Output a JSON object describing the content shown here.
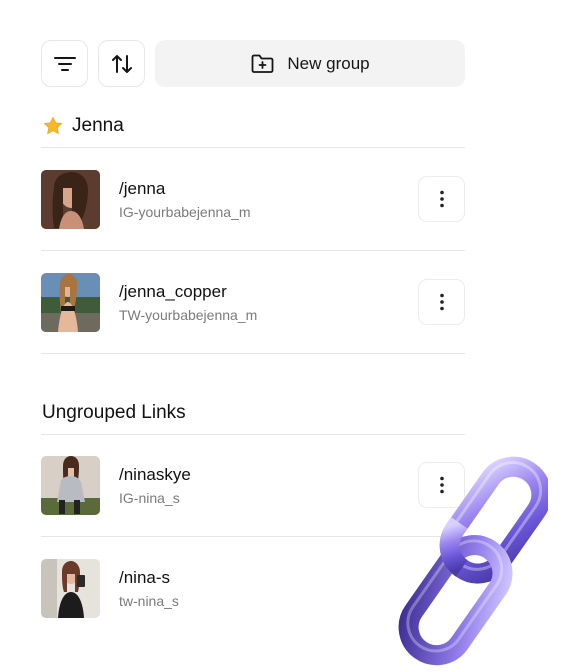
{
  "toolbar": {
    "filter_icon": "filter-lines-icon",
    "sort_icon": "sort-arrows-icon",
    "new_group_icon": "folder-plus-icon",
    "new_group_label": "New group"
  },
  "groups": [
    {
      "icon": "star-icon",
      "title": "Jenna",
      "links": [
        {
          "name": "/jenna",
          "sub": "IG-yourbabejenna_m"
        },
        {
          "name": "/jenna_copper",
          "sub": "TW-yourbabejenna_m"
        }
      ]
    }
  ],
  "ungrouped": {
    "title": "Ungrouped Links",
    "links": [
      {
        "name": "/ninaskye",
        "sub": "IG-nina_s"
      },
      {
        "name": "/nina-s",
        "sub": "tw-nina_s"
      }
    ]
  },
  "colors": {
    "star": "#F7B928",
    "button_bg": "#F3F3F3",
    "chain": "#8B78E8"
  }
}
